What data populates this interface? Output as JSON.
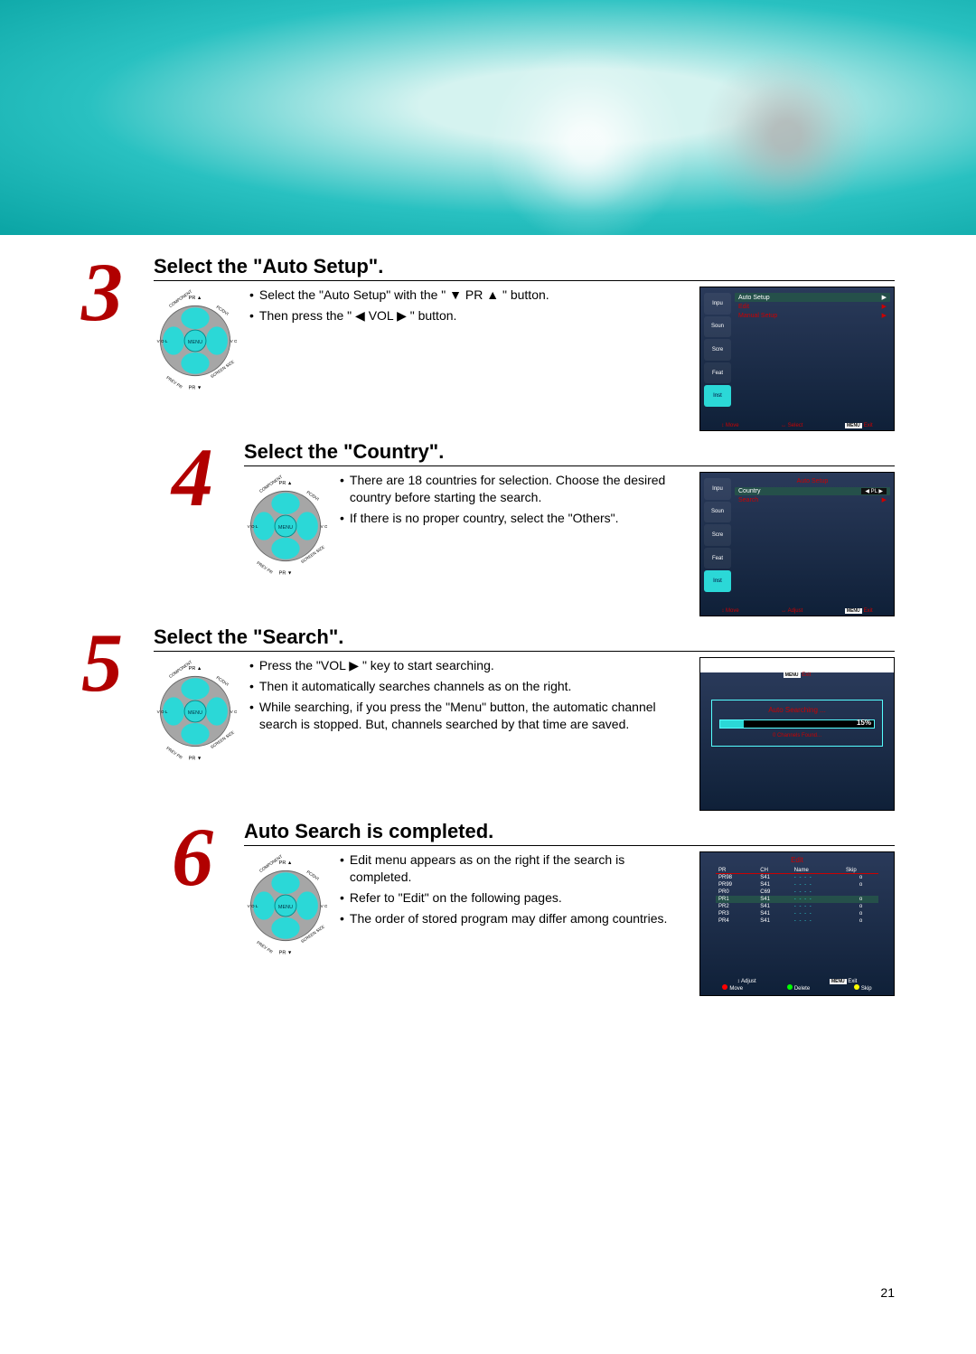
{
  "page_number": "21",
  "steps": [
    {
      "num": "3",
      "title": "Select the \"Auto Setup\".",
      "bullets": [
        "Select the \"Auto Setup\" with the \" ▼ PR ▲ \" button.",
        "Then press the \" ◀ VOL ▶ \" button."
      ],
      "osd": {
        "kind": "menu",
        "side": [
          "Input",
          "Sound",
          "Screen",
          "Feature",
          "Install"
        ],
        "side_active": 4,
        "rows": [
          {
            "label": "Auto Setup",
            "arrow": "▶",
            "sel": true
          },
          {
            "label": "Edit",
            "arrow": "▶"
          },
          {
            "label": "Manual Setup",
            "arrow": "▶"
          }
        ],
        "footer": [
          {
            "icon": "↕",
            "text": "Move"
          },
          {
            "icon": "↔",
            "text": "Select"
          },
          {
            "pill": "MENU",
            "text": "Exit"
          }
        ]
      }
    },
    {
      "num": "4",
      "title": "Select the \"Country\".",
      "indent": true,
      "bullets": [
        "There are 18 countries for selection. Choose the desired country before starting the search.",
        "If there is no proper country, select the \"Others\"."
      ],
      "osd": {
        "kind": "submenu",
        "title": "Auto Setup",
        "side": [
          "Input",
          "Sound",
          "Screen",
          "Feature",
          "Install"
        ],
        "side_active": 4,
        "rows": [
          {
            "label": "Country",
            "val": "PL",
            "sel": true
          },
          {
            "label": "Search",
            "arrow": "▶"
          }
        ],
        "footer": [
          {
            "icon": "↕",
            "text": "Move"
          },
          {
            "icon": "↔",
            "text": "Adjust"
          },
          {
            "pill": "MENU",
            "text": "Exit"
          }
        ]
      }
    },
    {
      "num": "5",
      "title": "Select the \"Search\".",
      "bullets": [
        "Press the \"VOL ▶ \" key to start searching.",
        "Then it automatically searches channels as on the right.",
        "While searching, if you press the \"Menu\" button, the automatic channel search is stopped. But, channels searched by that time are saved."
      ],
      "osd": {
        "kind": "search",
        "title": "Auto Searching ...",
        "percent": "15%",
        "percent_num": 15,
        "found": "0 Channels Found...",
        "exit": {
          "pill": "MENU",
          "text": "Exit"
        }
      }
    },
    {
      "num": "6",
      "title": "Auto Search is completed.",
      "indent": true,
      "bullets": [
        "Edit menu appears as on the right if the search is completed.",
        "Refer to \"Edit\" on the following pages.",
        "The order of stored program may differ among countries."
      ],
      "osd": {
        "kind": "edit",
        "title": "Edit",
        "headers": [
          "PR",
          "CH",
          "Name",
          "Skip"
        ],
        "rows": [
          {
            "pr": "PR98",
            "ch": "S41",
            "name": "- - - -",
            "skip": "o"
          },
          {
            "pr": "PR99",
            "ch": "S41",
            "name": "- - - -",
            "skip": "o"
          },
          {
            "pr": "PR0",
            "ch": "C69",
            "name": "- - - -",
            "skip": ""
          },
          {
            "pr": "PR1",
            "ch": "S41",
            "name": "- - - -",
            "skip": "o",
            "sel": true
          },
          {
            "pr": "PR2",
            "ch": "S41",
            "name": "- - - -",
            "skip": "o"
          },
          {
            "pr": "PR3",
            "ch": "S41",
            "name": "- - - -",
            "skip": "o"
          },
          {
            "pr": "PR4",
            "ch": "S41",
            "name": "- - - -",
            "skip": "o"
          }
        ],
        "footer1": [
          {
            "icon": "↕",
            "text": "Adjust"
          },
          {
            "pill": "MENU",
            "text": "Exit"
          }
        ],
        "footer2": [
          {
            "dot": "#f00",
            "text": "Move"
          },
          {
            "dot": "#0f0",
            "text": "Delete"
          },
          {
            "dot": "#ff0",
            "text": "Skip"
          }
        ]
      }
    }
  ],
  "remote_labels": {
    "top": "PR ▲",
    "bottom": "PR ▼",
    "left": "VOL",
    "right": "VOL",
    "center": "MENU",
    "tl": "COMPONENT",
    "tr": "PC/DVI",
    "bl": "PREV PR",
    "br": "SCREEN SIZE"
  }
}
